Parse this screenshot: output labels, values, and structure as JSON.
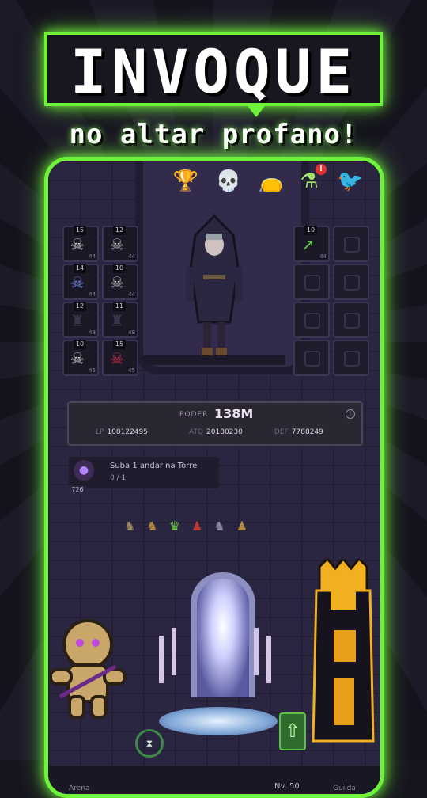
{
  "header": {
    "title": "INVOQUE",
    "subtitle": "no altar profano!"
  },
  "top_icons": [
    {
      "name": "trophy-icon",
      "glyph": "🏆"
    },
    {
      "name": "skull-icon",
      "glyph": "💀"
    },
    {
      "name": "loot-bag-icon",
      "glyph": "👝"
    },
    {
      "name": "potion-icon",
      "glyph": "⚗",
      "badge": "!"
    },
    {
      "name": "raven-icon",
      "glyph": "🐦"
    }
  ],
  "left_slots": [
    {
      "level": "15",
      "count": "44"
    },
    {
      "level": "12",
      "count": "44"
    },
    {
      "level": "14",
      "count": "44"
    },
    {
      "level": "10",
      "count": "44"
    },
    {
      "level": "12",
      "count": "48"
    },
    {
      "level": "11",
      "count": "48"
    },
    {
      "level": "10",
      "count": "45"
    },
    {
      "level": "15",
      "count": "45"
    }
  ],
  "right_slots": [
    {
      "level": "10",
      "count": "44"
    }
  ],
  "power": {
    "label": "PODER",
    "value": "138M",
    "stats": [
      {
        "key": "LP",
        "value": "108122495"
      },
      {
        "key": "ATQ",
        "value": "20180230"
      },
      {
        "key": "DEF",
        "value": "7788249"
      }
    ]
  },
  "quest": {
    "text": "Suba 1 andar na Torre",
    "progress": "0 / 1",
    "number": "726"
  },
  "nav": {
    "arena_label": "Arena",
    "level_label": "Nv. 50",
    "guild_label": "Guilda"
  },
  "colors": {
    "neon_green": "#6ff23a",
    "background": "#17141f",
    "dungeon": "#262238"
  }
}
